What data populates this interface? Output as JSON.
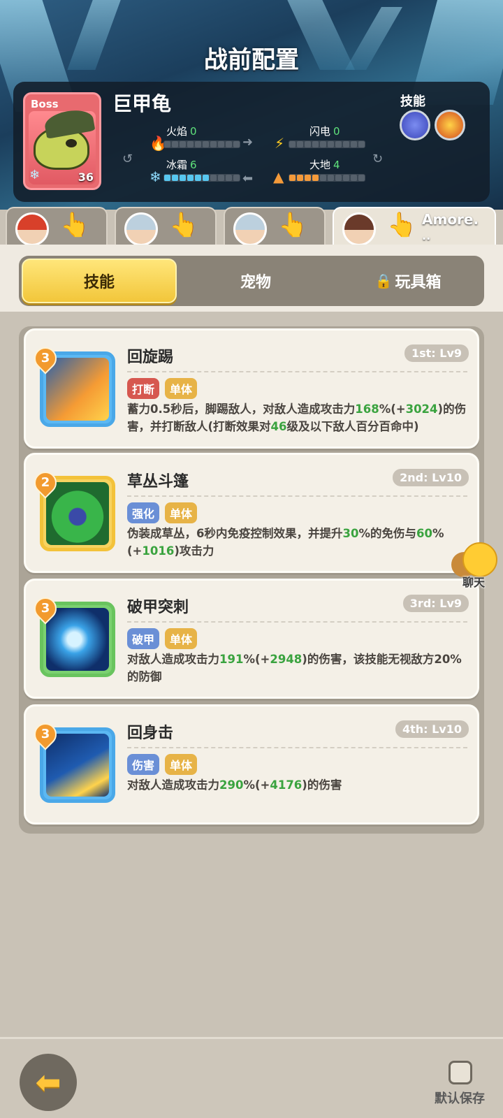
{
  "page": {
    "title": "战前配置"
  },
  "boss": {
    "tag": "Boss",
    "name": "巨甲龟",
    "level": "36",
    "stats": {
      "fire": {
        "label": "火焰",
        "value": "0",
        "segments": 0
      },
      "lightning": {
        "label": "闪电",
        "value": "0",
        "segments": 0
      },
      "ice": {
        "label": "冰霜",
        "value": "6",
        "segments": 6
      },
      "earth": {
        "label": "大地",
        "value": "4",
        "segments": 4
      }
    },
    "skills_label": "技能"
  },
  "heroes": [
    {
      "name": ""
    },
    {
      "name": ""
    },
    {
      "name": ""
    },
    {
      "name": "Amore.",
      "sub": ".."
    }
  ],
  "tabs": {
    "skills": "技能",
    "pets": "宠物",
    "toybox": "玩具箱"
  },
  "skills": [
    {
      "level": "3",
      "name": "回旋踢",
      "slot": "1st: Lv9",
      "tags": [
        "打断",
        "单体"
      ],
      "desc_parts": [
        "蓄力0.5秒后，脚踢敌人，对敌人造成攻击力",
        "168",
        "%(+",
        "3024",
        ")的伤害，并打断敌人(打断效果对",
        "46",
        "级及以下敌人百分百命中)"
      ]
    },
    {
      "level": "2",
      "name": "草丛斗篷",
      "slot": "2nd: Lv10",
      "tags": [
        "强化",
        "单体"
      ],
      "desc_parts": [
        "伪装成草丛，6秒内免疫控制效果，并提升",
        "30",
        "%的免伤与",
        "60",
        "%(+",
        "1016",
        ")攻击力"
      ]
    },
    {
      "level": "3",
      "name": "破甲突刺",
      "slot": "3rd: Lv9",
      "tags": [
        "破甲",
        "单体"
      ],
      "desc_parts": [
        "对敌人造成攻击力",
        "191",
        "%(+",
        "2948",
        ")的伤害，该技能无视敌方20%的防御"
      ]
    },
    {
      "level": "3",
      "name": "回身击",
      "slot": "4th: Lv10",
      "tags": [
        "伤害",
        "单体"
      ],
      "desc_parts": [
        "对敌人造成攻击力",
        "290",
        "%(+",
        "4176",
        ")的伤害"
      ]
    }
  ],
  "chat": {
    "label": "聊天"
  },
  "footer": {
    "default_save": "默认保存"
  },
  "colors": {
    "accent": "#f2c63a",
    "highlight": "#3aa33f",
    "boss_frame": "#e86a6f"
  }
}
